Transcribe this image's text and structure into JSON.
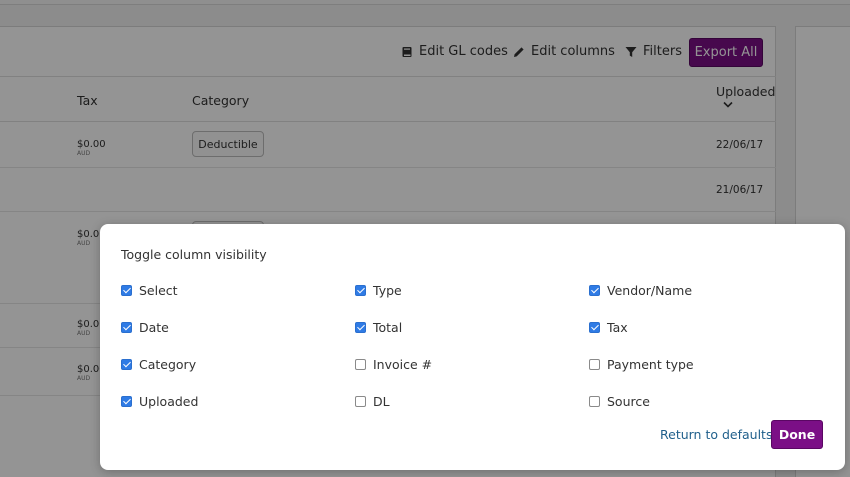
{
  "toolbar": {
    "edit_gl_label": "Edit GL codes",
    "edit_columns_label": "Edit columns",
    "filters_label": "Filters",
    "export_label": "Export All"
  },
  "table": {
    "headers": {
      "tax": "Tax",
      "category": "Category",
      "uploaded": "Uploaded"
    },
    "rows": [
      {
        "tax": "$0.00",
        "currency": "AUD",
        "category": "Deductible",
        "date": "22/06/17"
      },
      {
        "tax": "",
        "currency": "",
        "category": "",
        "date": "21/06/17"
      },
      {
        "tax": "$0.00",
        "currency": "AUD",
        "category": "",
        "date": ""
      },
      {
        "tax": "$0.00",
        "currency": "AUD",
        "category": "",
        "date": ""
      },
      {
        "tax": "$0.00",
        "currency": "AUD",
        "category": "",
        "date": ""
      }
    ]
  },
  "modal": {
    "title": "Toggle column visibility",
    "options": [
      {
        "label": "Select",
        "checked": true
      },
      {
        "label": "Type",
        "checked": true
      },
      {
        "label": "Vendor/Name",
        "checked": true
      },
      {
        "label": "Date",
        "checked": true
      },
      {
        "label": "Total",
        "checked": true
      },
      {
        "label": "Tax",
        "checked": true
      },
      {
        "label": "Category",
        "checked": true
      },
      {
        "label": "Invoice #",
        "checked": false
      },
      {
        "label": "Payment type",
        "checked": false
      },
      {
        "label": "Uploaded",
        "checked": true
      },
      {
        "label": "DL",
        "checked": false
      },
      {
        "label": "Source",
        "checked": false
      }
    ],
    "return_label": "Return to defaults",
    "done_label": "Done"
  },
  "colors": {
    "accent": "#7b0f86",
    "checkbox": "#2f7be5",
    "link": "#1f5f8b"
  }
}
